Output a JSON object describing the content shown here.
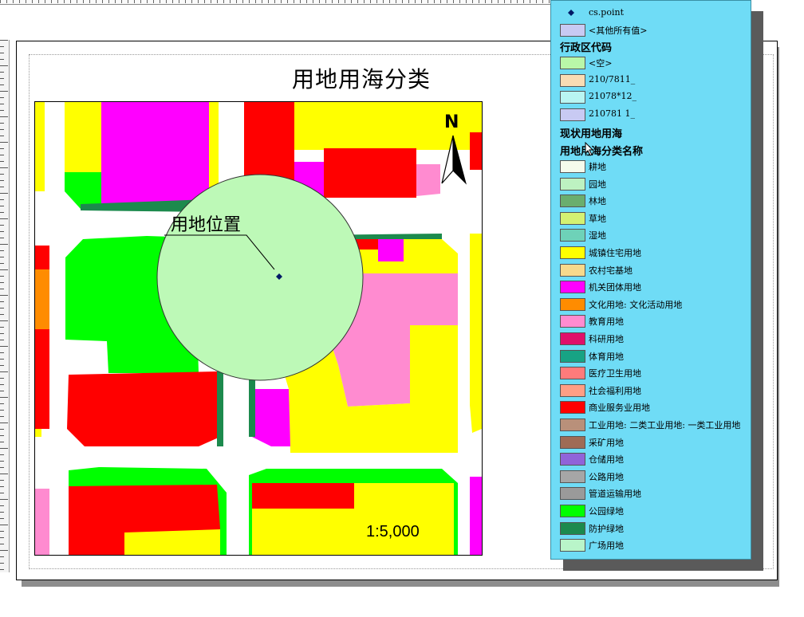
{
  "map": {
    "title": "用地用海分类",
    "location_label": "用地位置",
    "north_label": "N",
    "scale_text": "1:5,000"
  },
  "legend": {
    "point_layer": "cs.point",
    "other_values": "<其他所有值>",
    "admin_code_heading": "行政区代码",
    "admin_items": [
      {
        "label": "<空>",
        "color": "#b9f7a8"
      },
      {
        "label": "210/7811_",
        "color": "#f9dcb4"
      },
      {
        "label": "21078*12_",
        "color": "#b9f5f2"
      },
      {
        "label": "210781 1_",
        "color": "#c8caf3"
      }
    ],
    "current_use_heading": "现状用地用海",
    "class_heading": "用地用海分类名称",
    "classes": [
      {
        "label": "耕地",
        "color": "#f5fbec"
      },
      {
        "label": "园地",
        "color": "#bdf2c1"
      },
      {
        "label": "林地",
        "color": "#6aae6e"
      },
      {
        "label": "草地",
        "color": "#d4f172"
      },
      {
        "label": "湿地",
        "color": "#6ed2b8"
      },
      {
        "label": "城镇住宅用地",
        "color": "#ffff00"
      },
      {
        "label": "农村宅基地",
        "color": "#f7d98c"
      },
      {
        "label": "机关团体用地",
        "color": "#ff00ff"
      },
      {
        "label": "文化用地: 文化活动用地",
        "color": "#ff8c00"
      },
      {
        "label": "教育用地",
        "color": "#ff8bd0"
      },
      {
        "label": "科研用地",
        "color": "#e0106a"
      },
      {
        "label": "体育用地",
        "color": "#17a384"
      },
      {
        "label": "医疗卫生用地",
        "color": "#ff7b7b"
      },
      {
        "label": "社会福利用地",
        "color": "#ff9e85"
      },
      {
        "label": "商业服务业用地",
        "color": "#ff0000"
      },
      {
        "label": "工业用地: 二类工业用地: 一类工业用地",
        "color": "#b9907a"
      },
      {
        "label": "采矿用地",
        "color": "#9f6b55"
      },
      {
        "label": "仓储用地",
        "color": "#9064d9"
      },
      {
        "label": "公路用地",
        "color": "#a6a6a6"
      },
      {
        "label": "管道运输用地",
        "color": "#9a9a9a"
      },
      {
        "label": "公园绿地",
        "color": "#00ff00"
      },
      {
        "label": "防护绿地",
        "color": "#1c8a4d"
      },
      {
        "label": "广场用地",
        "color": "#b9f5c9"
      }
    ]
  }
}
